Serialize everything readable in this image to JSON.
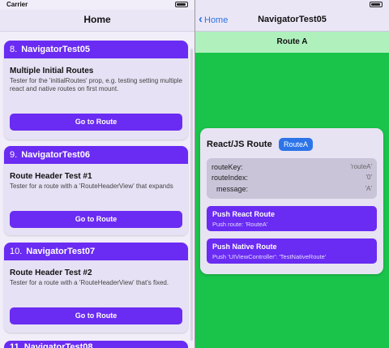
{
  "left": {
    "status": {
      "carrier": "Carrier"
    },
    "nav_title": "Home",
    "cards": [
      {
        "number": "8.",
        "name": "NavigatorTest05",
        "title": "Multiple Initial Routes",
        "description": "Tester for the 'initialRoutes' prop, e.g. testing setting multiple react and native routes on first mount.",
        "button": "Go to Route"
      },
      {
        "number": "9.",
        "name": "NavigatorTest06",
        "title": "Route Header Test #1",
        "description": "Tester for a route with a 'RouteHeaderView' that expands",
        "button": "Go to Route"
      },
      {
        "number": "10.",
        "name": "NavigatorTest07",
        "title": "Route Header Test #2",
        "description": "Tester for a route with a 'RouteHeaderView' that's fixed.",
        "button": "Go to Route"
      }
    ],
    "partial_card": "11. NavigatorTest08"
  },
  "right": {
    "back_label": "Home",
    "nav_title": "NavigatorTest05",
    "route_header": "Route A",
    "card_title": "React/JS Route",
    "badge": "RouteA",
    "props": [
      {
        "key": "routeKey:",
        "value": "'routeA'"
      },
      {
        "key": "routeIndex:",
        "value": "'0'"
      },
      {
        "key": "message:",
        "value": "'A'"
      }
    ],
    "push_react": {
      "title": "Push React Route",
      "subtitle": "Push route: 'RouteA'"
    },
    "push_native": {
      "title": "Push Native Route",
      "subtitle": "Push 'UIViewController': 'TestNativeRoute'"
    }
  },
  "colors": {
    "accent": "#6a2bf2",
    "route_bg": "#1ac34a",
    "link": "#2d74e8"
  }
}
